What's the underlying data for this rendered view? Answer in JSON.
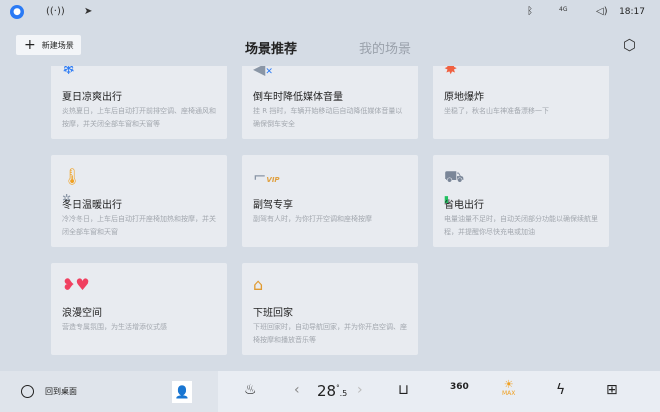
{
  "status_bar": {
    "time": "18:17",
    "signal": "4G",
    "icons": [
      "user-icon",
      "hotspot-icon",
      "location-icon",
      "bluetooth-icon",
      "signal-icon",
      "volume-icon"
    ]
  },
  "header": {
    "new_button": "新建场景",
    "tabs": [
      {
        "label": "场景推荐",
        "active": true
      },
      {
        "label": "我的场景",
        "active": false
      }
    ]
  },
  "cards": [
    {
      "title": "夏日凉爽出行",
      "desc": "炎热夏日，上车后自动打开前排空调、座椅通风和按摩，并关闭全部车窗和天窗等",
      "icon": "snowflake-thermometer-icon"
    },
    {
      "title": "倒车时降低媒体音量",
      "desc": "挂 R 挡时，车辆开始移动后自动降低媒体音量以确保倒车安全",
      "icon": "mute-speaker-icon"
    },
    {
      "title": "原地爆炸",
      "desc": "坐稳了，秋名山车神准备漂移一下",
      "icon": "explosion-icon"
    },
    {
      "title": "冬日温暖出行",
      "desc": "冷冷冬日，上车后自动打开座椅加热和按摩，并关闭全部车窗和天窗",
      "icon": "thermometer-fan-icon"
    },
    {
      "title": "副驾专享",
      "desc": "副驾有人时，为你打开空调和座椅按摩",
      "icon": "vip-seat-icon"
    },
    {
      "title": "省电出行",
      "desc": "电量油量不足时，自动关闭部分功能以确保续航里程，并提醒你尽快充电或加油",
      "icon": "car-battery-icon"
    },
    {
      "title": "浪漫空间",
      "desc": "营造专属氛围，为生活增添仪式感",
      "icon": "hearts-icon"
    },
    {
      "title": "下班回家",
      "desc": "下班回家时，自动导航回家，并为你开启空调、座椅按摩和播放音乐等",
      "icon": "home-icon"
    }
  ],
  "bottom_bar": {
    "home_label": "回到桌面",
    "temperature_main": "28",
    "temperature_decimal": ".5",
    "temperature_unit": "°",
    "cam_label": "360",
    "max_label": "MAX"
  }
}
